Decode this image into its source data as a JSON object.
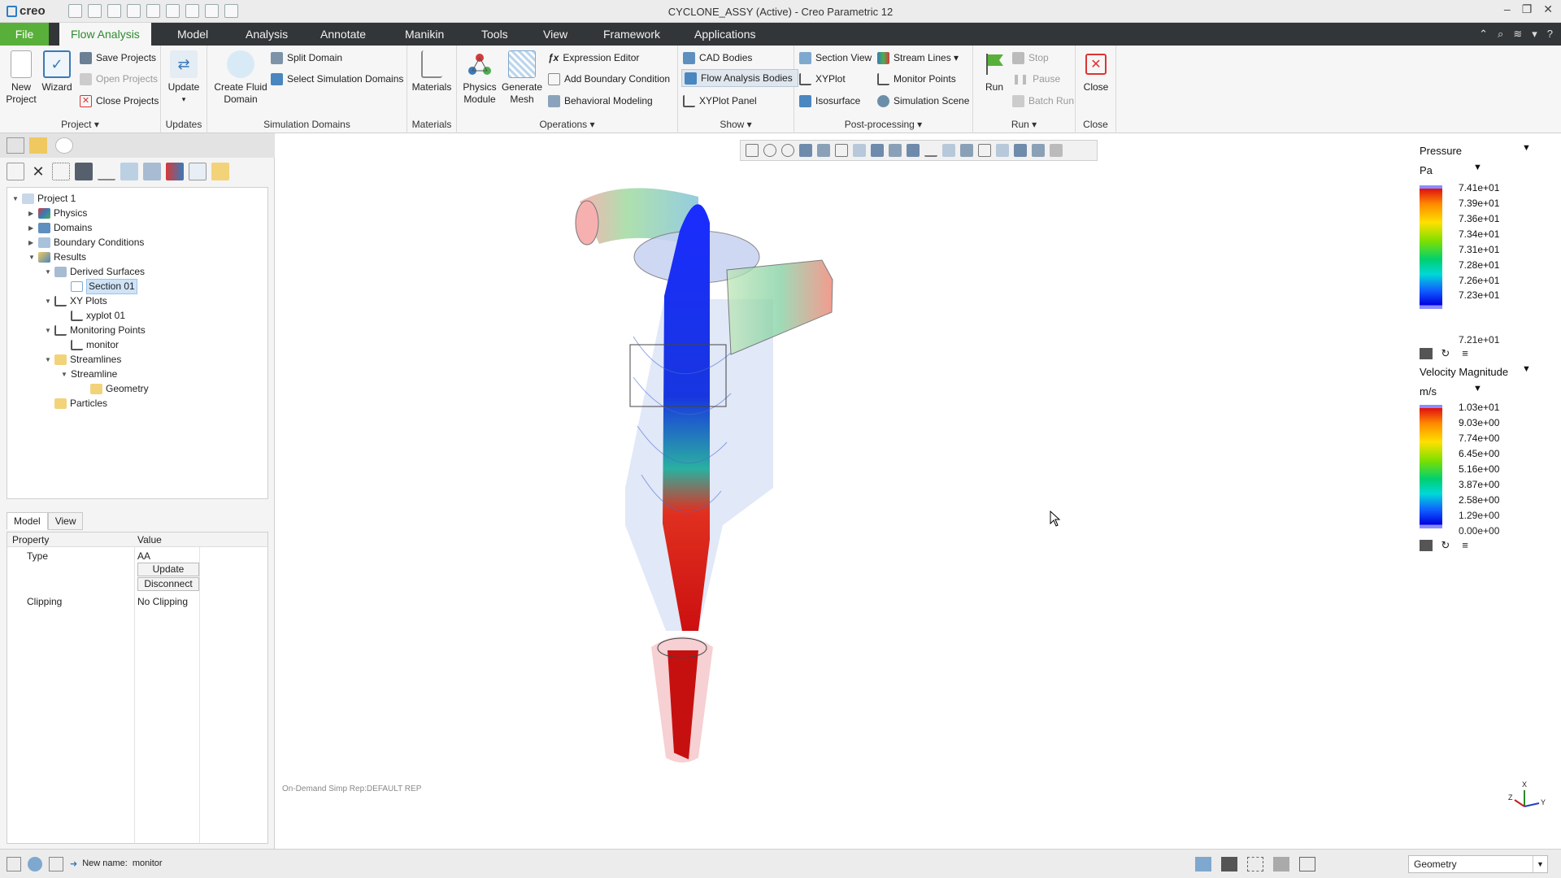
{
  "app": {
    "logo": "creo",
    "title": "CYCLONE_ASSY (Active) - Creo Parametric 12"
  },
  "menu": {
    "file": "File",
    "tabs": [
      "Flow Analysis",
      "Model",
      "Analysis",
      "Annotate",
      "Manikin",
      "Tools",
      "View",
      "Framework",
      "Applications"
    ]
  },
  "ribbon": {
    "project": {
      "label": "Project ▾",
      "new_project": "New\nProject",
      "wizard": "Wizard",
      "save_projects": "Save Projects",
      "open_projects": "Open Projects",
      "close_projects": "Close Projects"
    },
    "updates": {
      "label": "Updates",
      "update": "Update"
    },
    "simulation_domains": {
      "label": "Simulation Domains",
      "create_fluid_domain": "Create Fluid\nDomain",
      "split_domain": "Split Domain",
      "select_simulation_domains": "Select Simulation Domains"
    },
    "materials": {
      "label": "Materials",
      "materials": "Materials"
    },
    "operations": {
      "label": "Operations ▾",
      "physics_module": "Physics\nModule",
      "generate_mesh": "Generate\nMesh",
      "expression_editor": "Expression Editor",
      "add_boundary_condition": "Add Boundary Condition",
      "behavioral_modeling": "Behavioral Modeling"
    },
    "show": {
      "label": "Show ▾",
      "cad_bodies": "CAD Bodies",
      "flow_analysis_bodies": "Flow Analysis Bodies",
      "xyplot_panel": "XYPlot Panel"
    },
    "post_processing": {
      "label": "Post-processing ▾",
      "section_view": "Section View",
      "stream_lines": "Stream Lines ▾",
      "xyplot": "XYPlot",
      "monitor_points": "Monitor Points",
      "isosurface": "Isosurface",
      "simulation_scene": "Simulation Scene"
    },
    "run": {
      "label": "Run ▾",
      "run": "Run",
      "stop": "Stop",
      "pause": "Pause",
      "batch_run": "Batch Run"
    },
    "close": {
      "label": "Close",
      "close": "Close"
    }
  },
  "tree": {
    "project": "Project 1",
    "physics": "Physics",
    "domains": "Domains",
    "boundary_conditions": "Boundary Conditions",
    "results": "Results",
    "derived_surfaces": "Derived Surfaces",
    "section_01": "Section 01",
    "xy_plots": "XY Plots",
    "xyplot_01": "xyplot 01",
    "monitoring_points": "Monitoring Points",
    "monitor": "monitor",
    "streamlines": "Streamlines",
    "streamline": "Streamline",
    "geometry": "Geometry",
    "particles": "Particles"
  },
  "bottom_tabs": [
    "Model",
    "View"
  ],
  "properties": {
    "col_property": "Property",
    "col_value": "Value",
    "type_label": "Type",
    "type_value": "AA",
    "update_btn": "Update",
    "disconnect_btn": "Disconnect",
    "clipping_label": "Clipping",
    "clipping_value": "No Clipping"
  },
  "viewport": {
    "simprep": "On-Demand Simp Rep:DEFAULT REP"
  },
  "legend_pressure": {
    "title": "Pressure",
    "unit": "Pa",
    "ticks": [
      "7.41e+01",
      "7.39e+01",
      "7.36e+01",
      "7.34e+01",
      "7.31e+01",
      "7.28e+01",
      "7.26e+01",
      "7.23e+01",
      "7.21e+01"
    ]
  },
  "legend_velocity": {
    "title": "Velocity Magnitude",
    "unit": "m/s",
    "ticks": [
      "1.03e+01",
      "9.03e+00",
      "7.74e+00",
      "6.45e+00",
      "5.16e+00",
      "3.87e+00",
      "2.58e+00",
      "1.29e+00",
      "0.00e+00"
    ]
  },
  "triad": {
    "x": "X",
    "y": "Y",
    "z": "Z"
  },
  "status": {
    "new_name_label": "New name:",
    "new_name_value": "monitor",
    "filter_value": "Geometry"
  },
  "colors": {
    "accent_green": "#58b03a",
    "menubar": "#333638",
    "selection": "#cfe3f7"
  }
}
